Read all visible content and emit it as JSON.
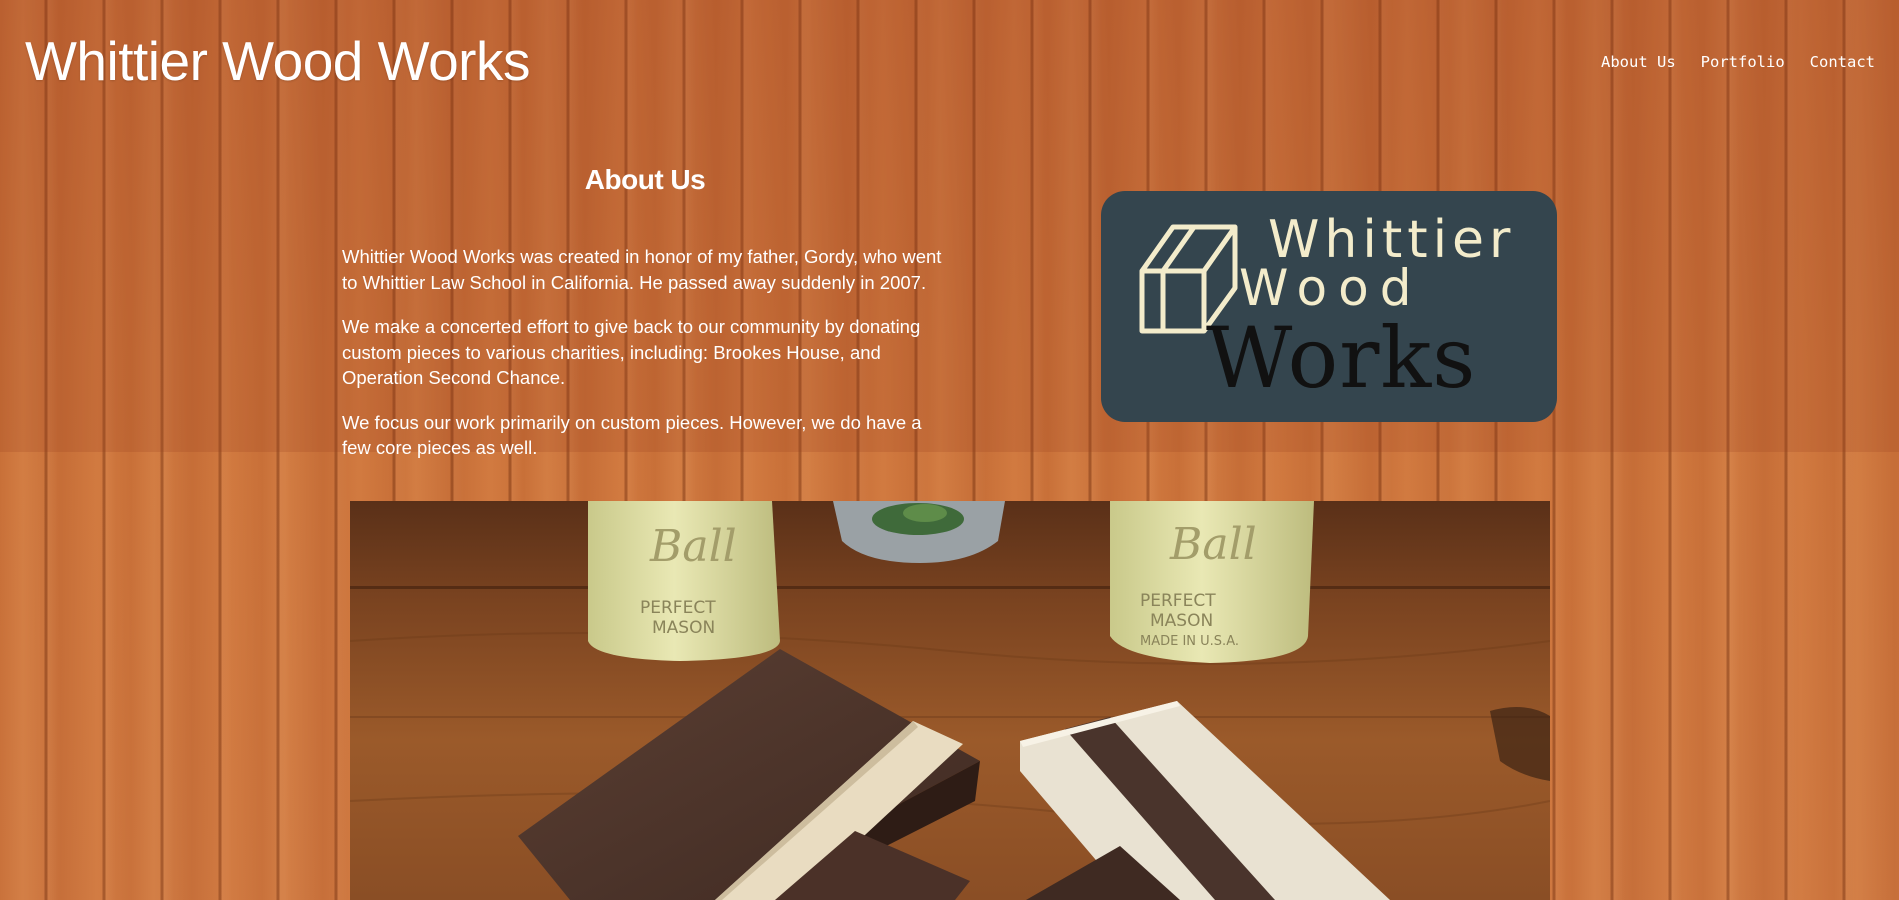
{
  "site": {
    "title": "Whittier Wood Works"
  },
  "nav": {
    "items": [
      {
        "label": "About Us",
        "name": "nav-about-us"
      },
      {
        "label": "Portfolio",
        "name": "nav-portfolio"
      },
      {
        "label": "Contact",
        "name": "nav-contact"
      }
    ]
  },
  "about": {
    "heading": "About Us",
    "paragraphs": [
      "Whittier Wood Works was created in honor of my father, Gordy, who went to Whittier Law School in California. He passed away suddenly in 2007.",
      "We make a concerted effort to give back to our community by donating custom pieces to various charities, including: Brookes House, and Operation Second Chance.",
      "We focus our work primarily on custom pieces. However, we do have a few core pieces as well."
    ]
  },
  "logo": {
    "line1": "Whittier",
    "line2": "Wood",
    "line3": "Works",
    "background_color": "#34454e",
    "accent_color": "#f3eccb",
    "dark_text_color": "#111111",
    "icon": "wood-block-icon"
  },
  "photo": {
    "jar_text_brand": "Ball",
    "jar_text_line1": "PERFECT",
    "jar_text_line2": "MASON",
    "jar_text_line3": "MADE IN U.S.A."
  },
  "colors": {
    "text": "#ffffff",
    "wood_base": "#c9703a"
  }
}
